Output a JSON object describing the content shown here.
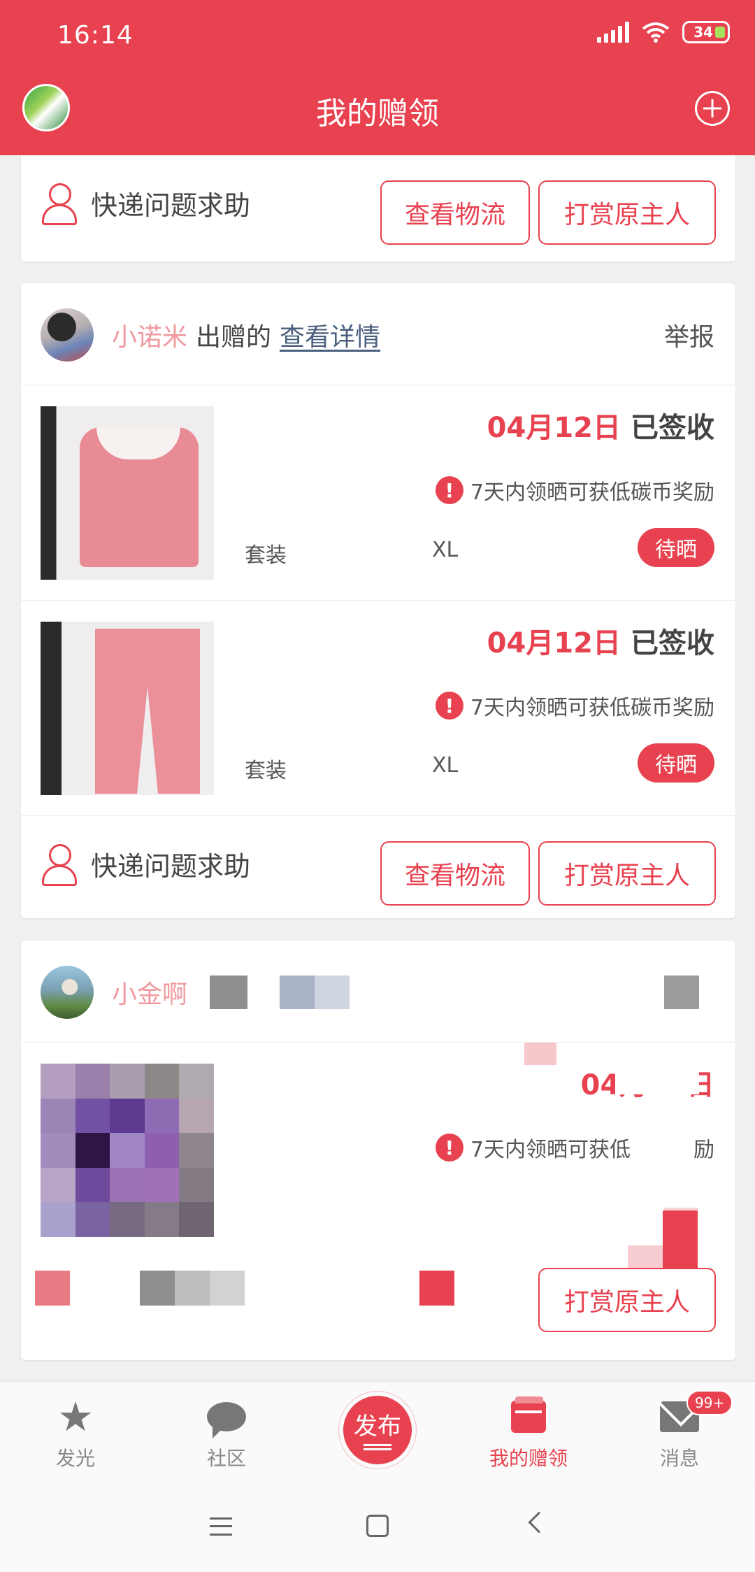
{
  "status": {
    "time": "16:14",
    "battery": "34"
  },
  "header": {
    "title": "我的赠领"
  },
  "card1": {
    "help": "快递问题求助",
    "logistics": "查看物流",
    "tip": "打赏原主人"
  },
  "card2": {
    "user": "小诺米",
    "gave": "出赠的",
    "detail": "查看详情",
    "report": "举报",
    "items": [
      {
        "date": "04月12日",
        "status": "已签收",
        "tip": "7天内领晒可获低碳币奖励",
        "category": "套装",
        "size": "XL",
        "badge": "待晒"
      },
      {
        "date": "04月12日",
        "status": "已签收",
        "tip": "7天内领晒可获低碳币奖励",
        "category": "套装",
        "size": "XL",
        "badge": "待晒"
      }
    ],
    "help": "快递问题求助",
    "logistics": "查看物流",
    "tip_btn": "打赏原主人"
  },
  "card3": {
    "user": "小金啊",
    "date": "04月11日",
    "tip_left": "7天内领晒可获低",
    "tip_right": "励",
    "tip_btn": "打赏原主人"
  },
  "nav": {
    "items": [
      {
        "label": "发光",
        "icon": "star-icon"
      },
      {
        "label": "社区",
        "icon": "chat-icon"
      },
      {
        "label": "我的赠领",
        "icon": "wallet-icon"
      },
      {
        "label": "消息",
        "icon": "mail-icon"
      }
    ],
    "publish": "发布",
    "msg_badge": "99+"
  },
  "colors": {
    "brand": "#e8414f",
    "name_pink": "#f0999f",
    "link": "#4a5f7e"
  }
}
